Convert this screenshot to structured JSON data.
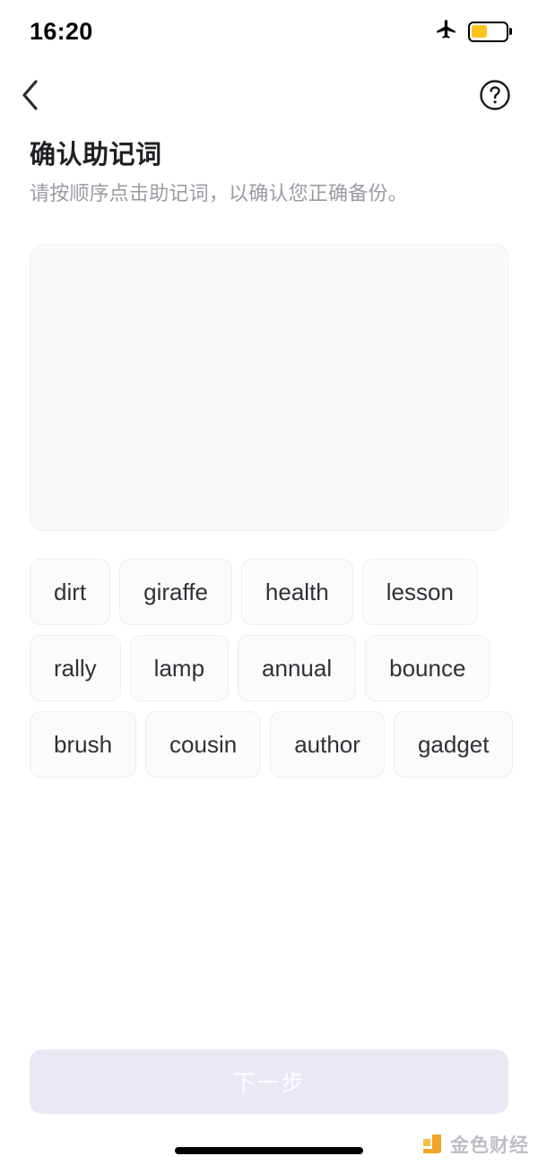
{
  "status_bar": {
    "time": "16:20",
    "airplane_icon": "airplane-mode-icon",
    "battery_icon": "battery-icon",
    "battery_level_percent": 45,
    "battery_color": "#FDC41F"
  },
  "nav_bar": {
    "back_icon": "chevron-left-icon",
    "help_icon": "question-mark-circle-icon"
  },
  "heading": {
    "title": "确认助记词",
    "subtitle": "请按顺序点击助记词，以确认您正确备份。"
  },
  "selection_panel": {
    "selected_words": [],
    "background_color": "#FAFAFA"
  },
  "word_pool": {
    "words": [
      "dirt",
      "giraffe",
      "health",
      "lesson",
      "rally",
      "lamp",
      "annual",
      "bounce",
      "brush",
      "cousin",
      "author",
      "gadget"
    ]
  },
  "footer": {
    "next_label": "下一步",
    "next_enabled": false,
    "next_background": "#E9E9F6",
    "next_text_color": "#FDFDFF"
  },
  "watermark": {
    "text": "金色财经",
    "logo_icon": "jinse-logo-icon",
    "logo_color": "#F0A01E"
  }
}
